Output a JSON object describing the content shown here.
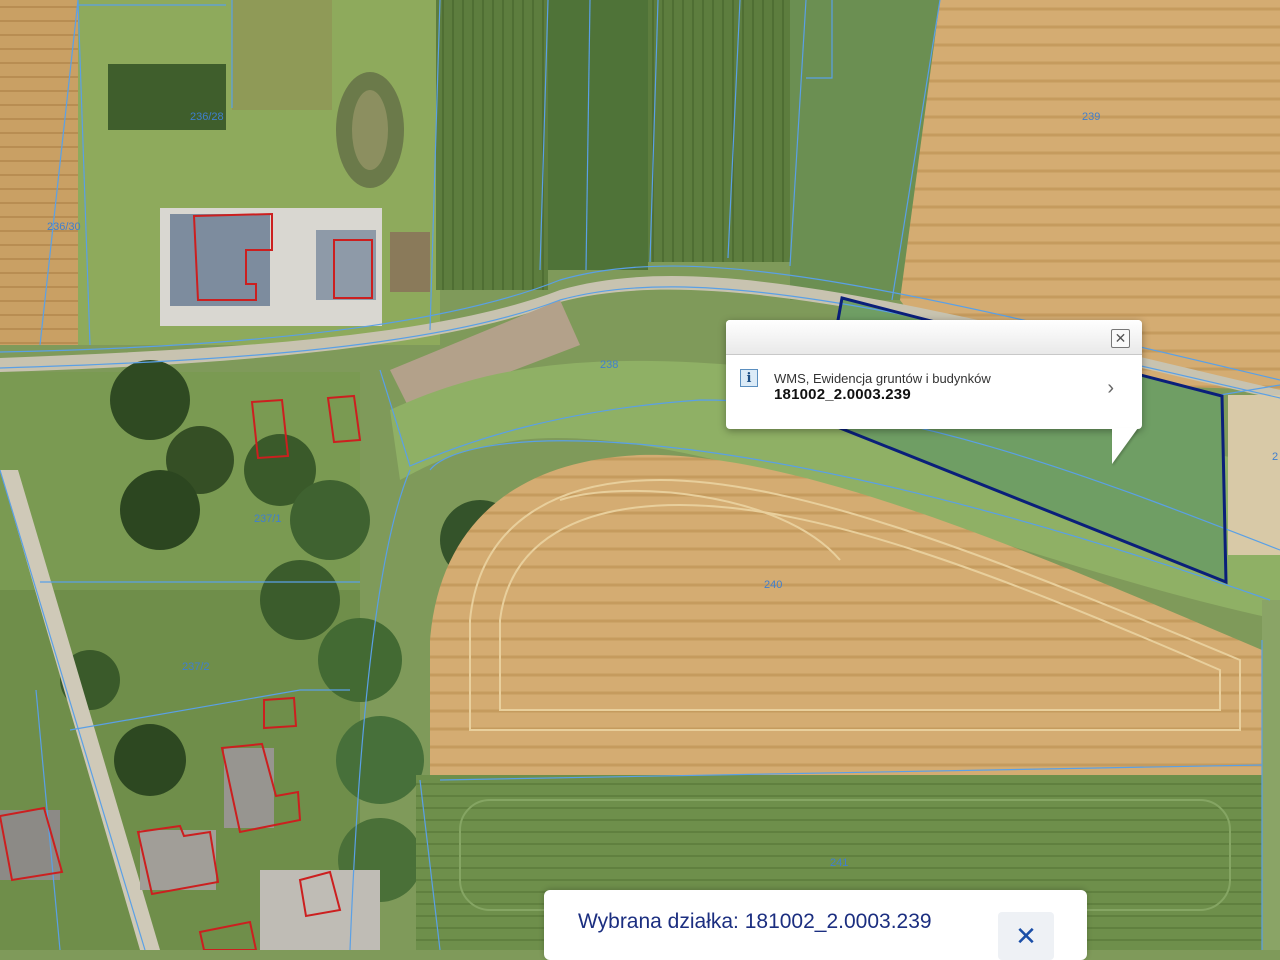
{
  "map": {
    "parcel_labels": [
      "236/30",
      "236/28",
      "238",
      "239",
      "237/1",
      "237/2",
      "240",
      "241",
      "2"
    ]
  },
  "popup": {
    "close_icon": "close-x-icon",
    "info_icon": "info-icon",
    "layer_name": "WMS, Ewidencja gruntów i budynków",
    "parcel_id": "181002_2.0003.239",
    "chevron_icon": "chevron-right-icon"
  },
  "selection_bar": {
    "label": "Wybrana działka: 181002_2.0003.239",
    "close_icon": "close-x-icon"
  },
  "colors": {
    "parcel_boundary": "#5aa0e6",
    "building_outline": "#cc1f1f",
    "selected_parcel": "#0a1f7a",
    "selection_text": "#1b2e80"
  }
}
